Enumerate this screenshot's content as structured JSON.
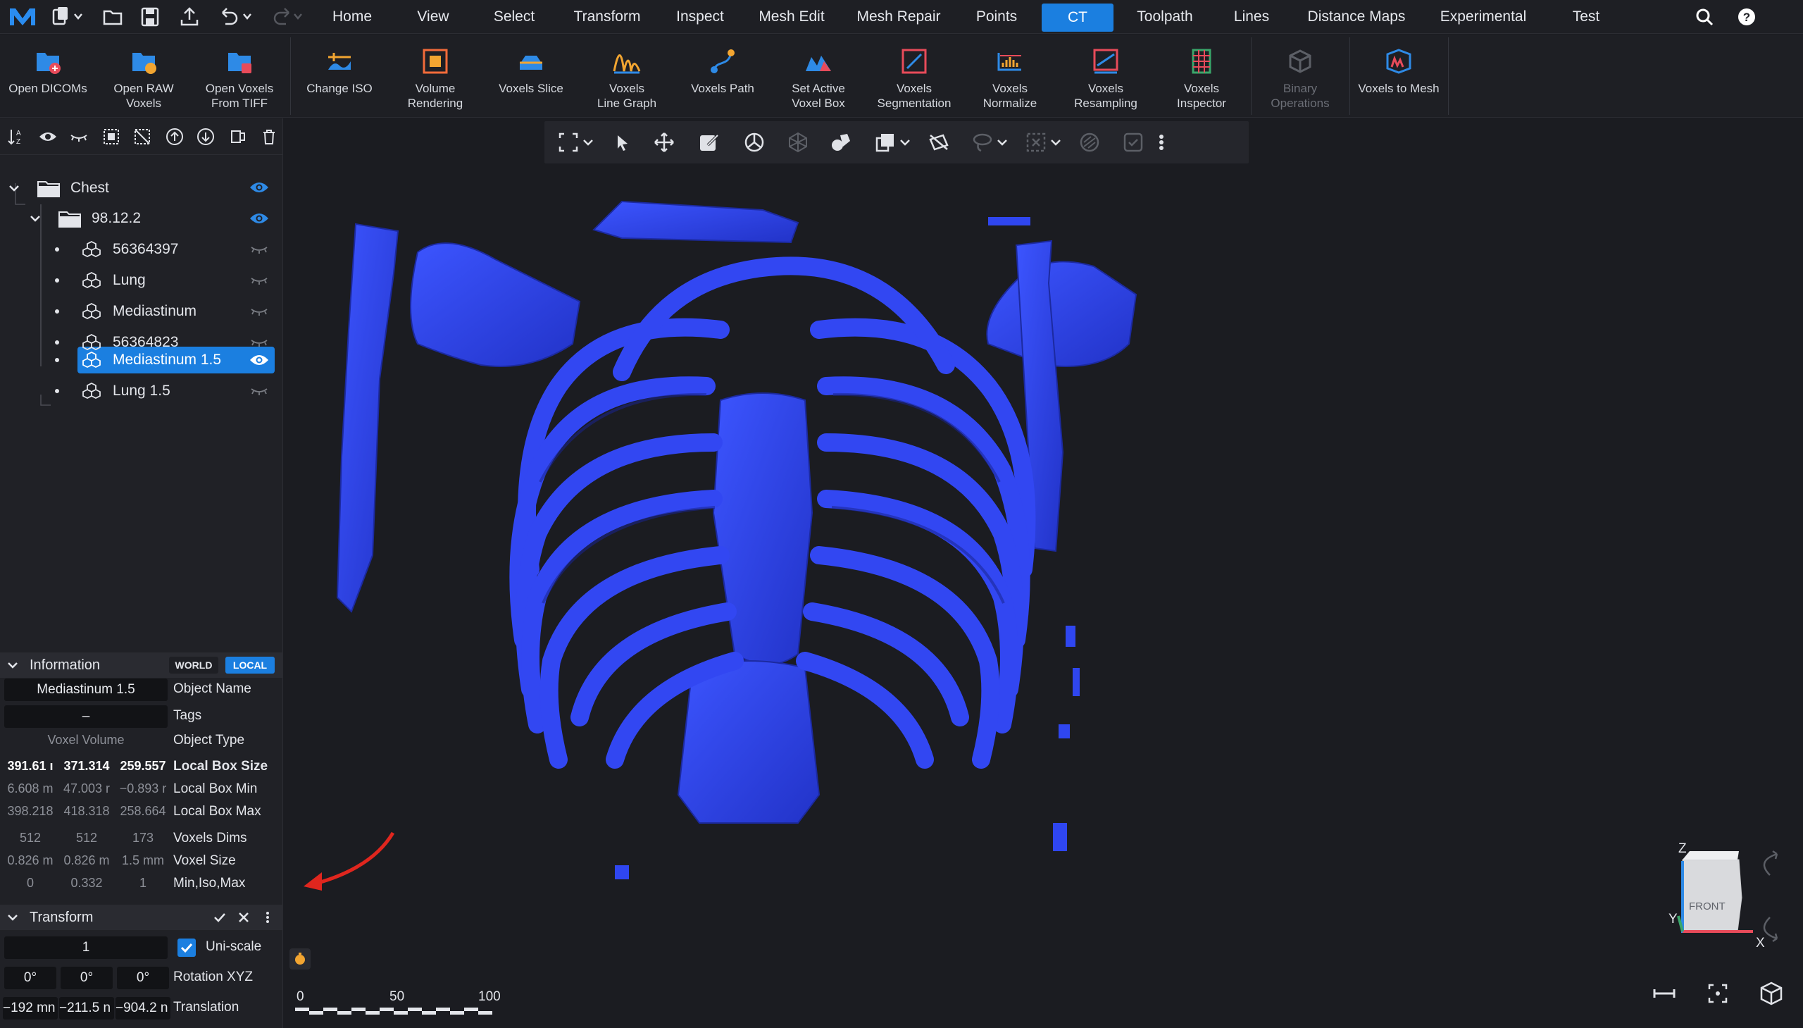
{
  "menubar": {
    "tabs": [
      "Home",
      "View",
      "Select",
      "Transform",
      "Inspect",
      "Mesh Edit",
      "Mesh Repair",
      "Points",
      "CT",
      "Toolpath",
      "Lines",
      "Distance Maps",
      "Experimental",
      "Test"
    ],
    "active_tab": "CT",
    "icons": [
      "logo-icon",
      "new-file-icon",
      "open-folder-icon",
      "save-icon",
      "export-icon",
      "undo-icon",
      "redo-icon",
      "search-icon",
      "help-icon"
    ]
  },
  "ribbon": {
    "items": [
      {
        "label": "Open DICOMs",
        "icon": "open-dicoms-icon"
      },
      {
        "label": "Open RAW\nVoxels",
        "icon": "open-raw-voxels-icon"
      },
      {
        "label": "Open Voxels\nFrom TIFF",
        "icon": "open-voxels-tiff-icon"
      },
      {
        "label": "Change ISO",
        "icon": "change-iso-icon"
      },
      {
        "label": "Volume\nRendering",
        "icon": "volume-rendering-icon"
      },
      {
        "label": "Voxels Slice",
        "icon": "voxels-slice-icon"
      },
      {
        "label": "Voxels\nLine Graph",
        "icon": "voxels-line-graph-icon"
      },
      {
        "label": "Voxels Path",
        "icon": "voxels-path-icon"
      },
      {
        "label": "Set Active\nVoxel Box",
        "icon": "set-active-voxel-box-icon"
      },
      {
        "label": "Voxels\nSegmentation",
        "icon": "voxels-segmentation-icon"
      },
      {
        "label": "Voxels\nNormalize",
        "icon": "voxels-normalize-icon"
      },
      {
        "label": "Voxels\nResampling",
        "icon": "voxels-resampling-icon"
      },
      {
        "label": "Voxels\nInspector",
        "icon": "voxels-inspector-icon"
      },
      {
        "label": "Binary\nOperations",
        "icon": "binary-operations-icon"
      },
      {
        "label": "Voxels to Mesh",
        "icon": "voxels-to-mesh-icon"
      }
    ]
  },
  "scene_tree": {
    "items": [
      {
        "label": "Chest",
        "type": "folder",
        "visible": true
      },
      {
        "label": "98.12.2",
        "type": "folder",
        "visible": true
      },
      {
        "label": "56364397",
        "type": "voxels",
        "visible": false
      },
      {
        "label": "Lung",
        "type": "voxels",
        "visible": false
      },
      {
        "label": "Mediastinum",
        "type": "voxels",
        "visible": false
      },
      {
        "label": "56364823",
        "type": "voxels",
        "visible": false
      },
      {
        "label": "Mediastinum 1.5",
        "type": "voxels",
        "visible": true,
        "selected": true
      },
      {
        "label": "Lung 1.5",
        "type": "voxels",
        "visible": false
      }
    ]
  },
  "information": {
    "title": "Information",
    "world_label": "WORLD",
    "local_label": "LOCAL",
    "object_name": "Mediastinum 1.5",
    "object_name_label": "Object Name",
    "tags": "–",
    "tags_label": "Tags",
    "object_type": "Voxel Volume",
    "object_type_label": "Object Type",
    "local_box_size": [
      "391.61 ı",
      "371.314",
      "259.557"
    ],
    "local_box_size_label": "Local Box Size",
    "local_box_min": [
      "6.608 m",
      "47.003 r",
      "−0.893 r"
    ],
    "local_box_min_label": "Local Box Min",
    "local_box_max": [
      "398.218",
      "418.318",
      "258.664"
    ],
    "local_box_max_label": "Local Box Max",
    "voxels_dims": [
      "512",
      "512",
      "173"
    ],
    "voxels_dims_label": "Voxels Dims",
    "voxel_size": [
      "0.826 m",
      "0.826 m",
      "1.5 mm"
    ],
    "voxel_size_label": "Voxel Size",
    "min_iso_max": [
      "0",
      "0.332",
      "1"
    ],
    "min_iso_max_label": "Min,Iso,Max"
  },
  "transform": {
    "title": "Transform",
    "scale": "1",
    "uniscale_label": "Uni-scale",
    "uniscale_checked": true,
    "rotation": [
      "0°",
      "0°",
      "0°"
    ],
    "rotation_label": "Rotation XYZ",
    "translation": [
      "−192 mn",
      "−211.5 n",
      "−904.2 n"
    ],
    "translation_label": "Translation"
  },
  "viewport": {
    "scale_bar": [
      "0",
      "50",
      "100"
    ],
    "view_cube_face": "FRONT",
    "axis_labels": [
      "Z",
      "Y",
      "X"
    ],
    "model_color": "#2f46f0"
  },
  "colors": {
    "accent": "#1b7fe0",
    "annotation_arrow": "#e0261e"
  }
}
